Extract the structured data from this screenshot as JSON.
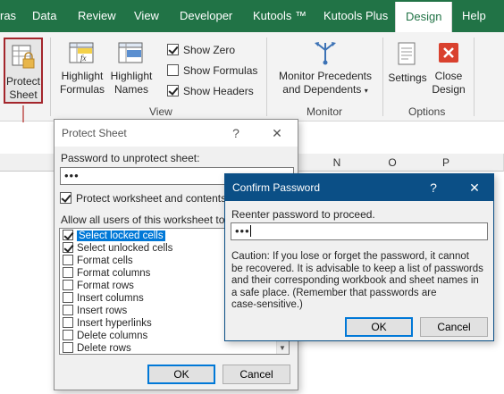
{
  "tabs": [
    "ras",
    "Data",
    "Review",
    "View",
    "Developer",
    "Kutools ™",
    "Kutools Plus",
    "Design",
    "Help"
  ],
  "ribbon": {
    "protect_sheet_line1": "Protect",
    "protect_sheet_line2": "Sheet",
    "highlight_formulas_line1": "Highlight",
    "highlight_formulas_line2": "Formulas",
    "highlight_names_line1": "Highlight",
    "highlight_names_line2": "Names",
    "show_zero": "Show Zero",
    "show_formulas": "Show Formulas",
    "show_headers": "Show Headers",
    "group_view": "View",
    "monitor_line1": "Monitor Precedents",
    "monitor_line2": "and Dependents",
    "group_monitor": "Monitor",
    "settings": "Settings",
    "close_design_line1": "Close",
    "close_design_line2": "Design",
    "group_options": "Options"
  },
  "sheet": {
    "columns": [
      "N",
      "O",
      "P"
    ]
  },
  "protect_dialog": {
    "title": "Protect Sheet",
    "help": "?",
    "close": "✕",
    "password_label": "Password to unprotect sheet:",
    "password_value": "•••",
    "protect_contents_label": "Protect worksheet and contents",
    "allow_label": "Allow all users of this worksheet to:",
    "items": [
      {
        "label": "Select locked cells",
        "checked": true,
        "selected": true
      },
      {
        "label": "Select unlocked cells",
        "checked": true,
        "selected": false
      },
      {
        "label": "Format cells",
        "checked": false,
        "selected": false
      },
      {
        "label": "Format columns",
        "checked": false,
        "selected": false
      },
      {
        "label": "Format rows",
        "checked": false,
        "selected": false
      },
      {
        "label": "Insert columns",
        "checked": false,
        "selected": false
      },
      {
        "label": "Insert rows",
        "checked": false,
        "selected": false
      },
      {
        "label": "Insert hyperlinks",
        "checked": false,
        "selected": false
      },
      {
        "label": "Delete columns",
        "checked": false,
        "selected": false
      },
      {
        "label": "Delete rows",
        "checked": false,
        "selected": false
      }
    ],
    "ok": "OK",
    "cancel": "Cancel"
  },
  "confirm_dialog": {
    "title": "Confirm Password",
    "help": "?",
    "close": "✕",
    "reenter_label": "Reenter password to proceed.",
    "password_value": "•••",
    "caution_lines": [
      "Caution: If you lose or forget the password, it cannot",
      "be recovered. It is advisable to keep a list of passwords",
      "and their corresponding workbook and sheet names in",
      "a safe place.  (Remember that passwords are",
      "case-sensitive.)"
    ],
    "ok": "OK",
    "cancel": "Cancel"
  },
  "colors": {
    "excel_green": "#217346",
    "highlight_border": "#a4262c",
    "arrow": "#c0504d",
    "title_bar": "#0b4f86",
    "selection": "#0078d7"
  }
}
